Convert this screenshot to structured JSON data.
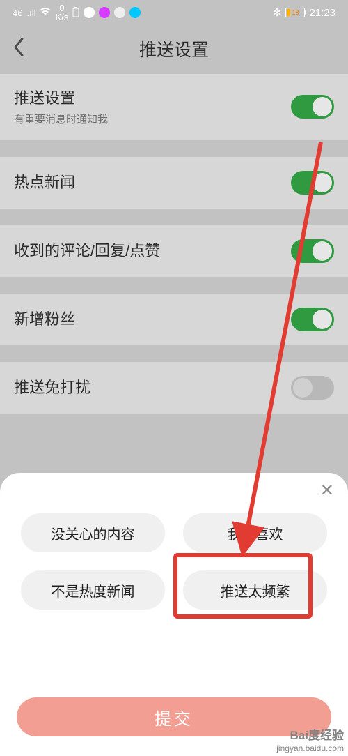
{
  "statusbar": {
    "network": "46",
    "signal": ".ıll",
    "speed_v": "0",
    "speed_u": "K/s",
    "bt": "✻",
    "battery_pct": "18",
    "time": "21:23"
  },
  "header": {
    "title": "推送设置"
  },
  "settings": [
    {
      "label": "推送设置",
      "sub": "有重要消息时通知我",
      "on": true
    },
    {
      "label": "热点新闻",
      "sub": "",
      "on": true
    },
    {
      "label": "收到的评论/回复/点赞",
      "sub": "",
      "on": true
    },
    {
      "label": "新增粉丝",
      "sub": "",
      "on": true
    },
    {
      "label": "推送免打扰",
      "sub": "",
      "on": false
    }
  ],
  "modal": {
    "options": [
      "没关心的内容",
      "我不喜欢",
      "不是热度新闻",
      "推送太频繁"
    ],
    "submit": "提交"
  },
  "watermark": {
    "brand": "Bai度经验",
    "url": "jingyan.baidu.com"
  }
}
